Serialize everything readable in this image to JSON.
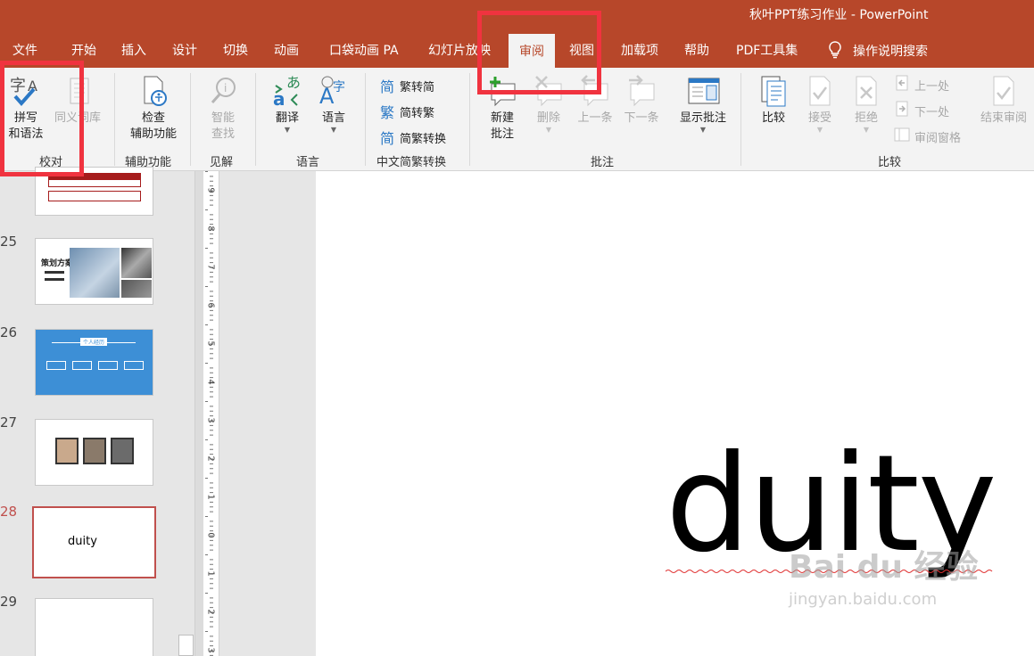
{
  "window": {
    "title": "秋叶PPT练习作业  -  PowerPoint"
  },
  "tabs": [
    {
      "label": "文件"
    },
    {
      "label": "开始"
    },
    {
      "label": "插入"
    },
    {
      "label": "设计"
    },
    {
      "label": "切换"
    },
    {
      "label": "动画"
    },
    {
      "label": "口袋动画 PA"
    },
    {
      "label": "幻灯片放映"
    },
    {
      "label": "审阅"
    },
    {
      "label": "视图"
    },
    {
      "label": "加载项"
    },
    {
      "label": "帮助"
    },
    {
      "label": "PDF工具集"
    }
  ],
  "active_tab": "审阅",
  "tell_me": "操作说明搜索",
  "ribbon": {
    "proofing": {
      "label": "校对",
      "spelling": [
        "拼写",
        "和语法"
      ],
      "thesaurus": "同义词库"
    },
    "accessibility": {
      "label": "辅助功能",
      "check": [
        "检查",
        "辅助功能"
      ]
    },
    "insights": {
      "label": "见解",
      "smart_lookup": [
        "智能",
        "查找"
      ]
    },
    "language": {
      "label": "语言",
      "translate": "翻译",
      "language": "语言"
    },
    "chinese_conversion": {
      "label": "中文简繁转换",
      "to_simplified": "繁转简",
      "to_traditional": "简转繁",
      "convert": "简繁转换",
      "icon_chars": [
        "简",
        "繁",
        "简"
      ]
    },
    "comments": {
      "label": "批注",
      "new": [
        "新建",
        "批注"
      ],
      "delete": "删除",
      "previous": "上一条",
      "next": "下一条",
      "show": "显示批注"
    },
    "compare": {
      "label": "比较",
      "compare": "比较",
      "accept": "接受",
      "reject": "拒绝",
      "prev": "上一处",
      "next": "下一处",
      "pane": "审阅窗格",
      "end": "结束审阅"
    }
  },
  "slides": [
    {
      "num": "25",
      "text": "策划方案"
    },
    {
      "num": "26",
      "text": "个人经历"
    },
    {
      "num": "27",
      "text": ""
    },
    {
      "num": "28",
      "text": "duity",
      "selected": true
    },
    {
      "num": "29",
      "text": ""
    }
  ],
  "ruler": [
    "9",
    "8",
    "7",
    "6",
    "5",
    "4",
    "3",
    "2",
    "1",
    "0",
    "1",
    "2",
    "3"
  ],
  "slide": {
    "text": "duity"
  },
  "watermark": {
    "logo": "Bai du 经验",
    "url": "jingyan.baidu.com"
  },
  "colors": {
    "accent": "#b7472a",
    "highlight": "#f0333f",
    "selected": "#c0504d"
  }
}
